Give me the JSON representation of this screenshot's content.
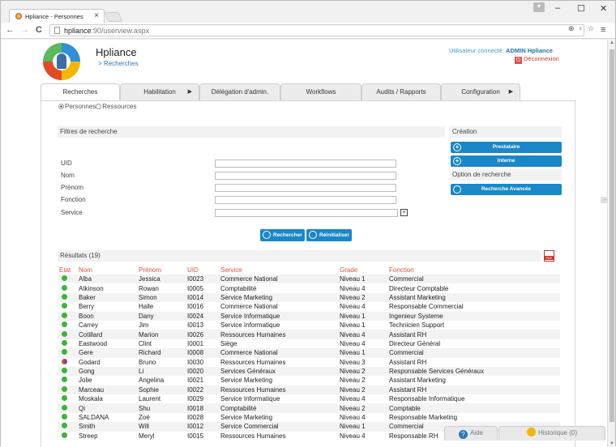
{
  "browser": {
    "tab_title": "Hpliance - Personnes",
    "tab_close": "×",
    "url_host": "hpliance",
    "url_path": ":90/userview.aspx",
    "back": "←",
    "forward": "→",
    "reload": "C",
    "min": "‒",
    "max": "☐",
    "close": "✕"
  },
  "header": {
    "app_title": "Hpliance",
    "breadcrumb": "> Recherches",
    "user_label": "Utilisateur connecté:",
    "user_name": "ADMIN Hpliance",
    "logout": "Déconnexion"
  },
  "tabs": [
    {
      "label": "Recherches"
    },
    {
      "label": "Habilitation"
    },
    {
      "label": "Délégation d'admin."
    },
    {
      "label": "Workflows"
    },
    {
      "label": "Audits / Rapports"
    },
    {
      "label": "Configuration"
    }
  ],
  "filters": {
    "title": "Filtres de recherche",
    "radio_persons": "Personnes",
    "radio_resources": "Ressources",
    "uid_label": "UID",
    "nom_label": "Nom",
    "prenom_label": "Prénom",
    "fonction_label": "Fonction",
    "service_label": "Service",
    "search_button": "Rechercher",
    "reset_button": "Réinitialiser",
    "clear": "×"
  },
  "creation": {
    "title": "Création",
    "prestataire": "Prestataire",
    "interne": "Interne",
    "option_title": "Option de recherche",
    "advanced": "Recherche Avancée"
  },
  "results": {
    "title": "Résultats (19)",
    "columns": [
      "Etat",
      "Nom",
      "Prénom",
      "UID",
      "Service",
      "Grade",
      "Fonction"
    ],
    "rows": [
      {
        "state": "green",
        "nom": "Alba",
        "prenom": "Jessica",
        "uid": "I0023",
        "service": "Commerce National",
        "grade": "Niveau 1",
        "fonction": "Commercial"
      },
      {
        "state": "green",
        "nom": "Atkinson",
        "prenom": "Rowan",
        "uid": "I0005",
        "service": "Comptabilité",
        "grade": "Niveau 4",
        "fonction": "Directeur Comptable"
      },
      {
        "state": "green",
        "nom": "Baker",
        "prenom": "Simon",
        "uid": "I0014",
        "service": "Service Marketing",
        "grade": "Niveau 2",
        "fonction": "Assistant Marketing"
      },
      {
        "state": "green",
        "nom": "Berry",
        "prenom": "Halle",
        "uid": "I0016",
        "service": "Commerce National",
        "grade": "Niveau 4",
        "fonction": "Responsable Commercial"
      },
      {
        "state": "green",
        "nom": "Boon",
        "prenom": "Dany",
        "uid": "I0024",
        "service": "Service Informatique",
        "grade": "Niveau 1",
        "fonction": "Ingenieur Systeme"
      },
      {
        "state": "green",
        "nom": "Carrey",
        "prenom": "Jim",
        "uid": "I0013",
        "service": "Service Informatique",
        "grade": "Niveau 1",
        "fonction": "Technicien Support"
      },
      {
        "state": "green",
        "nom": "Cotillard",
        "prenom": "Marion",
        "uid": "I0026",
        "service": "Ressources Humaines",
        "grade": "Niveau 4",
        "fonction": "Assistant RH"
      },
      {
        "state": "green",
        "nom": "Eastwood",
        "prenom": "Clint",
        "uid": "I0001",
        "service": "Siège",
        "grade": "Niveau 4",
        "fonction": "Directeur Général"
      },
      {
        "state": "green",
        "nom": "Gere",
        "prenom": "Richard",
        "uid": "I0008",
        "service": "Commerce National",
        "grade": "Niveau 1",
        "fonction": "Commercial"
      },
      {
        "state": "mixed",
        "nom": "Godard",
        "prenom": "Bruno",
        "uid": "I0030",
        "service": "Ressources Humaines",
        "grade": "Niveau 3",
        "fonction": "Assistant RH"
      },
      {
        "state": "green",
        "nom": "Gong",
        "prenom": "Li",
        "uid": "I0020",
        "service": "Services Généraux",
        "grade": "Niveau 2",
        "fonction": "Responsable Services Généraux"
      },
      {
        "state": "green",
        "nom": "Jolie",
        "prenom": "Angelina",
        "uid": "I0021",
        "service": "Service Marketing",
        "grade": "Niveau 2",
        "fonction": "Assistant Marketing"
      },
      {
        "state": "green",
        "nom": "Marceau",
        "prenom": "Sophie",
        "uid": "I0022",
        "service": "Ressources Humaines",
        "grade": "Niveau 2",
        "fonction": "Assistant RH"
      },
      {
        "state": "green",
        "nom": "Moskala",
        "prenom": "Laurent",
        "uid": "I0029",
        "service": "Service Informatique",
        "grade": "Niveau 4",
        "fonction": "Responsable Informatique"
      },
      {
        "state": "green",
        "nom": "Qi",
        "prenom": "Shu",
        "uid": "I0018",
        "service": "Comptabilité",
        "grade": "Niveau 2",
        "fonction": "Comptable"
      },
      {
        "state": "green",
        "nom": "SALDANA",
        "prenom": "Zoé",
        "uid": "I0028",
        "service": "Service Marketing",
        "grade": "Niveau 4",
        "fonction": "Responsable Marketing"
      },
      {
        "state": "green",
        "nom": "Smith",
        "prenom": "Will",
        "uid": "I0012",
        "service": "Service Commercial",
        "grade": "Niveau 1",
        "fonction": "Commercial"
      },
      {
        "state": "green",
        "nom": "Streep",
        "prenom": "Meryl",
        "uid": "I0015",
        "service": "Ressources Humaines",
        "grade": "Niveau 4",
        "fonction": "Responsable RH"
      }
    ]
  },
  "footer": {
    "help": "Aide",
    "history": "Historique",
    "history_count": "(0)"
  },
  "colors": {
    "accent": "#1a87c8",
    "header_red": "#e0543a",
    "state_green": "#3cb33a"
  }
}
